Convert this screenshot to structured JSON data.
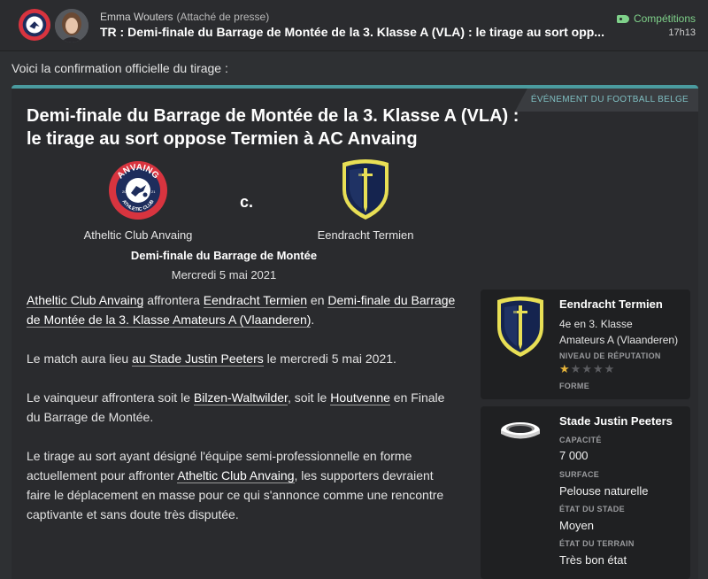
{
  "header": {
    "sender_name": "Emma Wouters",
    "sender_role": "(Attaché de presse)",
    "subject": "TR : Demi-finale du Barrage de Montée de la 3. Klasse A (VLA) : le tirage au sort opp...",
    "category": "Compétitions",
    "time": "17h13",
    "club_badge_text": "ANVAING"
  },
  "intro": "Voici la confirmation officielle du tirage :",
  "card": {
    "badge": "ÉVÉNEMENT DU FOOTBALL BELGE",
    "title": "Demi-finale du Barrage de Montée de la 3. Klasse A (VLA) : le tirage au sort oppose Termien à AC Anvaing",
    "home_team": "Atheltic Club Anvaing",
    "home_crest": {
      "top_text": "ANVAING",
      "bottom_text": "ATHLETIC CLUB",
      "year_left": "20",
      "year_right": "21"
    },
    "vs": "c.",
    "away_team": "Eendracht Termien",
    "competition": "Demi-finale du Barrage de Montée",
    "date": "Mercredi 5 mai 2021"
  },
  "body": {
    "p1_link1": "Atheltic Club Anvaing",
    "p1_t1": " affrontera ",
    "p1_link2": "Eendracht Termien",
    "p1_t2": " en ",
    "p1_link3": "Demi-finale du Barrage de Montée de la 3. Klasse Amateurs A (Vlaanderen)",
    "p1_t3": ".",
    "p2_t1": "Le match aura lieu ",
    "p2_link1": "au Stade Justin Peeters",
    "p2_t2": " le mercredi 5 mai 2021.",
    "p3_t1": "Le vainqueur affrontera soit le ",
    "p3_link1": "Bilzen-Waltwilder",
    "p3_t2": ", soit le ",
    "p3_link2": "Houtvenne",
    "p3_t3": " en ",
    "p3_link3": "Finale du Barrage de Montée",
    "p3_t4": ".",
    "p4_t1": "Le tirage au sort ayant désigné l'équipe semi-professionnelle en forme actuellement pour affronter ",
    "p4_link1": "Atheltic Club Anvaing",
    "p4_t2": ", les supporters devraient faire le déplacement en masse pour ce qui s'annonce comme une rencontre captivante et sans doute très disputée."
  },
  "team_panel": {
    "name": "Eendracht Termien",
    "line1": "4e en 3. Klasse",
    "line2": "Amateurs A (Vlaanderen)",
    "reputation_label": "NIVEAU DE RÉPUTATION",
    "reputation_stars": 1,
    "reputation_max": 5,
    "form_label": "FORME"
  },
  "stadium_panel": {
    "name": "Stade Justin Peeters",
    "capacity_label": "CAPACITÉ",
    "capacity": "7 000",
    "surface_label": "SURFACE",
    "surface": "Pelouse naturelle",
    "state_label": "ÉTAT DU STADE",
    "state": "Moyen",
    "pitch_label": "ÉTAT DU TERRAIN",
    "pitch": "Très bon état"
  },
  "colors": {
    "accent_teal": "#4a9b9f",
    "category_green": "#7fd18a",
    "anvaing_red": "#d8343f",
    "anvaing_navy": "#1e2d5c",
    "termien_navy": "#15244f",
    "termien_yellow": "#e8df55",
    "star_gold": "#e6b43a"
  },
  "icons": [
    "club-badge-icon",
    "person-avatar-icon",
    "tag-icon",
    "anvaing-crest-icon",
    "termien-crest-icon",
    "stadium-icon",
    "star-icon"
  ]
}
